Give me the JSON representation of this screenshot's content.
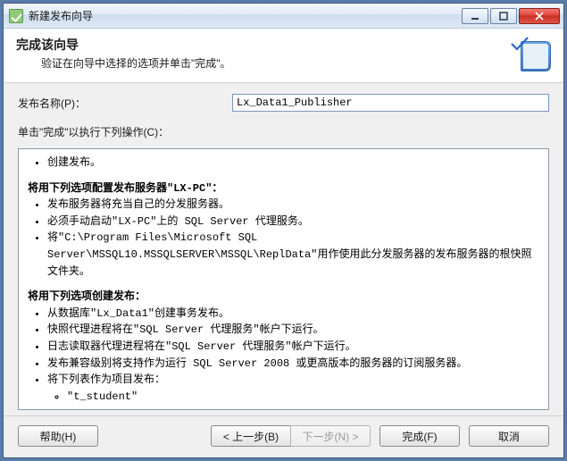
{
  "window": {
    "title": "新建发布向导"
  },
  "header": {
    "title": "完成该向导",
    "subtitle": "验证在向导中选择的选项并单击\"完成\"。"
  },
  "form": {
    "publish_name_label": "发布名称(P)：",
    "publish_name_value": "Lx_Data1_Publisher",
    "instruction": "单击\"完成\"以执行下列操作(C)："
  },
  "summary": {
    "section1": {
      "item1": "创建发布。"
    },
    "section2": {
      "heading": "将用下列选项配置发布服务器\"LX-PC\"：",
      "item1": "发布服务器将充当自己的分发服务器。",
      "item2": "必须手动启动\"LX-PC\"上的 SQL Server 代理服务。",
      "item3": "将\"C:\\Program Files\\Microsoft SQL Server\\MSSQL10.MSSQLSERVER\\MSSQL\\ReplData\"用作使用此分发服务器的发布服务器的根快照文件夹。"
    },
    "section3": {
      "heading": "将用下列选项创建发布：",
      "item1": "从数据库\"Lx_Data1\"创建事务发布。",
      "item2": "快照代理进程将在\"SQL Server 代理服务\"帐户下运行。",
      "item3": "日志读取器代理进程将在\"SQL Server 代理服务\"帐户下运行。",
      "item4": "发布兼容级别将支持作为运行 SQL Server 2008 或更高版本的服务器的订阅服务器。",
      "item5": "将下列表作为项目发布：",
      "sub1": "\"t_student\""
    }
  },
  "buttons": {
    "help": "帮助(H)",
    "back": "< 上一步(B)",
    "next": "下一步(N) >",
    "finish": "完成(F)",
    "cancel": "取消"
  }
}
